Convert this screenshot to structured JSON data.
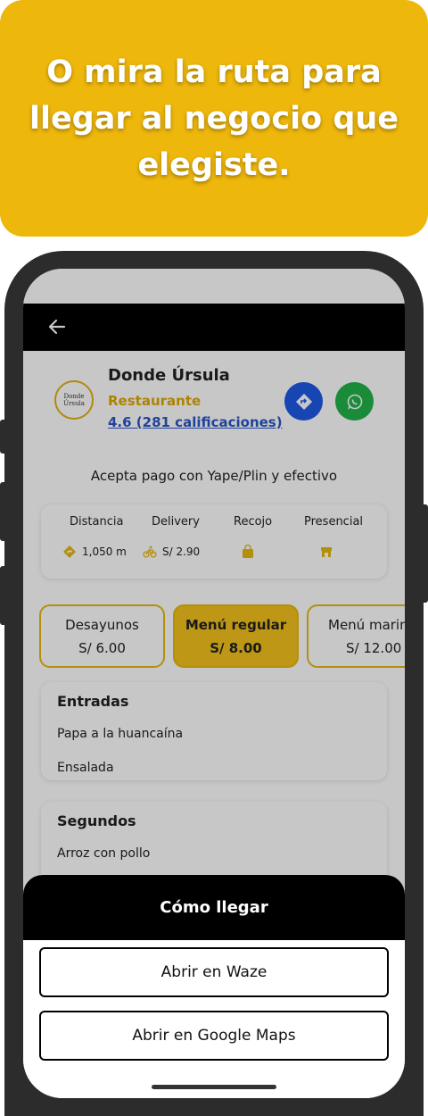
{
  "banner": {
    "text": "O mira la ruta para llegar al negocio que elegiste."
  },
  "business": {
    "logo_text": "Donde Úrsula",
    "name": "Donde Úrsula",
    "type": "Restaurante",
    "rating": "4.6 (281 calificaciones)"
  },
  "payment_note": "Acepta pago con Yape/Plin y efectivo",
  "info": {
    "distance_label": "Distancia",
    "distance_value": "1,050 m",
    "delivery_label": "Delivery",
    "delivery_value": "S/ 2.90",
    "pickup_label": "Recojo",
    "inperson_label": "Presencial"
  },
  "menu_tabs": [
    {
      "name": "Desayunos",
      "price": "S/ 6.00"
    },
    {
      "name": "Menú regular",
      "price": "S/ 8.00"
    },
    {
      "name": "Menú marino",
      "price": "S/ 12.00"
    }
  ],
  "sections": [
    {
      "title": "Entradas",
      "items": [
        "Papa a la huancaína",
        "Ensalada"
      ]
    },
    {
      "title": "Segundos",
      "items": [
        "Arroz con pollo"
      ]
    }
  ],
  "sheet": {
    "title": "Cómo llegar",
    "waze_label": "Abrir en Waze",
    "gmaps_label": "Abrir en Google Maps"
  },
  "colors": {
    "accent": "#eeb70c",
    "route": "#1e5ae6",
    "whatsapp": "#20b24a"
  }
}
